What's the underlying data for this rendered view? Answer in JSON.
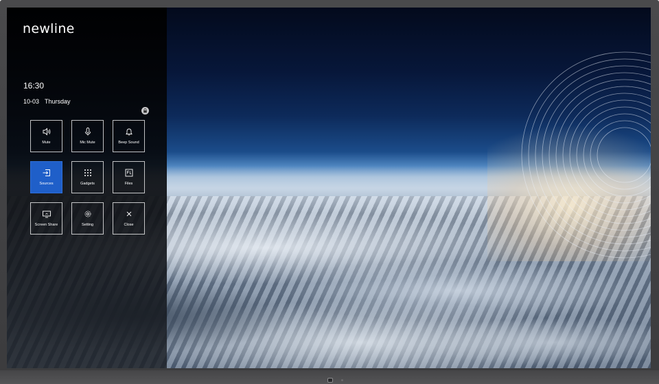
{
  "panel": {
    "brand": "newline",
    "time": "16:30",
    "date": "10-03",
    "weekday": "Thursday"
  },
  "tiles": [
    {
      "label": "Mute",
      "icon": "speaker-icon",
      "active": false
    },
    {
      "label": "Mic Mute",
      "icon": "microphone-icon",
      "active": false
    },
    {
      "label": "Beep Sound",
      "icon": "bell-icon",
      "active": false
    },
    {
      "label": "Sources",
      "icon": "input-source-icon",
      "active": true
    },
    {
      "label": "Gadgets",
      "icon": "grid-icon",
      "active": false
    },
    {
      "label": "Files",
      "icon": "folder-icon",
      "active": false
    },
    {
      "label": "Screen Share",
      "icon": "screen-share-icon",
      "active": false
    },
    {
      "label": "Setting",
      "icon": "gear-icon",
      "active": false
    },
    {
      "label": "Close",
      "icon": "close-icon",
      "active": false
    }
  ],
  "colors": {
    "active_tile": "#1f5fc9",
    "panel_background": "#000000",
    "text": "#ffffff"
  }
}
